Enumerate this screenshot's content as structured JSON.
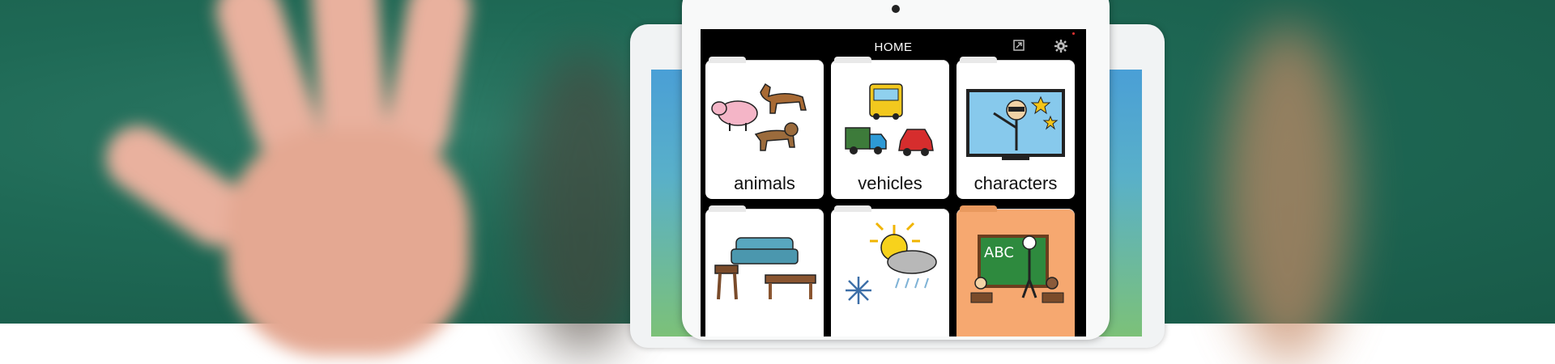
{
  "app": {
    "title": "HOME",
    "toolbar": {
      "resize_icon": "resize-icon",
      "settings_icon": "gear-icon"
    }
  },
  "tiles": [
    {
      "label": "animals",
      "icon": "animals-picture"
    },
    {
      "label": "vehicles",
      "icon": "vehicles-picture"
    },
    {
      "label": "characters",
      "icon": "characters-picture"
    },
    {
      "label": "",
      "icon": "furniture-picture"
    },
    {
      "label": "",
      "icon": "weather-picture"
    },
    {
      "label": "",
      "icon": "school-picture"
    }
  ],
  "colors": {
    "background": "#1f6a56",
    "screen": "#000000",
    "tile": "#ffffff",
    "tile_highlight": "#f6a870"
  }
}
